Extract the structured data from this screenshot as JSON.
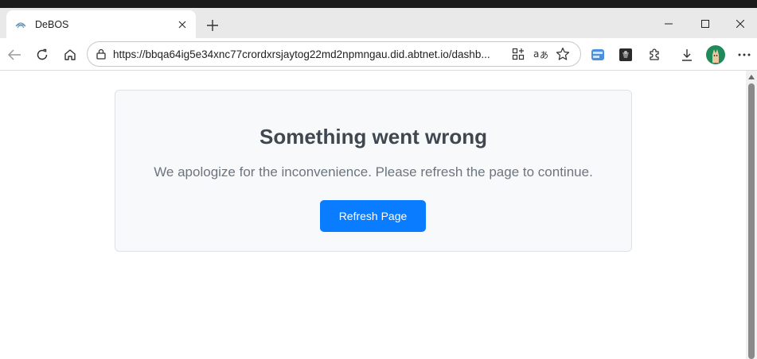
{
  "browser": {
    "tab_title": "DeBOS",
    "tab_favicon": "debos-favicon-icon",
    "url": "https://bbqa64ig5e34xnc77crordxrsjaytog22md2npmngau.did.abtnet.io/dashb..."
  },
  "page": {
    "error_title": "Something went wrong",
    "error_message": "We apologize for the inconvenience. Please refresh the page to continue.",
    "refresh_label": "Refresh Page"
  },
  "colors": {
    "accent": "#0a7cff",
    "card_bg": "#f8f9fa",
    "card_border": "#dee2e6",
    "title": "#3f4750",
    "message": "#6c757d"
  }
}
